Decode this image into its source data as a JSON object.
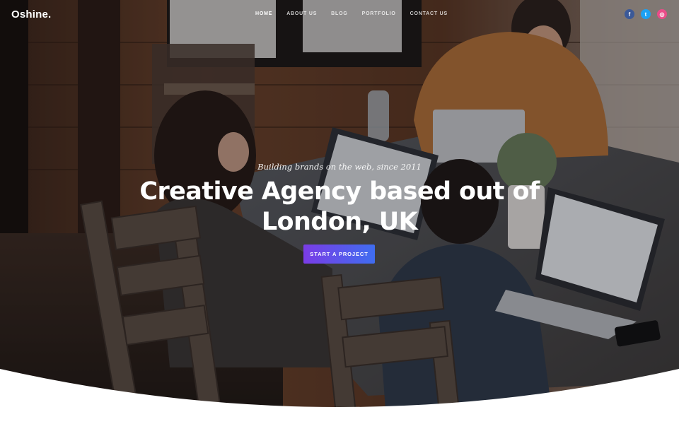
{
  "brand": {
    "logo": "Oshine."
  },
  "nav": {
    "items": [
      {
        "label": "HOME",
        "active": true
      },
      {
        "label": "ABOUT US",
        "active": false
      },
      {
        "label": "BLOG",
        "active": false
      },
      {
        "label": "PORTFOLIO",
        "active": false
      },
      {
        "label": "CONTACT US",
        "active": false
      }
    ]
  },
  "social": [
    {
      "icon": "facebook-icon",
      "glyph": "f",
      "color": "#3b5998"
    },
    {
      "icon": "twitter-icon",
      "glyph": "t",
      "color": "#1da1f2"
    },
    {
      "icon": "dribbble-icon",
      "glyph": "◎",
      "color": "#ea4c89"
    }
  ],
  "hero": {
    "tagline": "Building brands on the web, since 2011",
    "headline_line1": "Creative Agency based out of",
    "headline_line2": "London, UK",
    "cta_label": "START A PROJECT"
  },
  "colors": {
    "cta_gradient_start": "#7a3ce6",
    "cta_gradient_end": "#3f6df0"
  }
}
